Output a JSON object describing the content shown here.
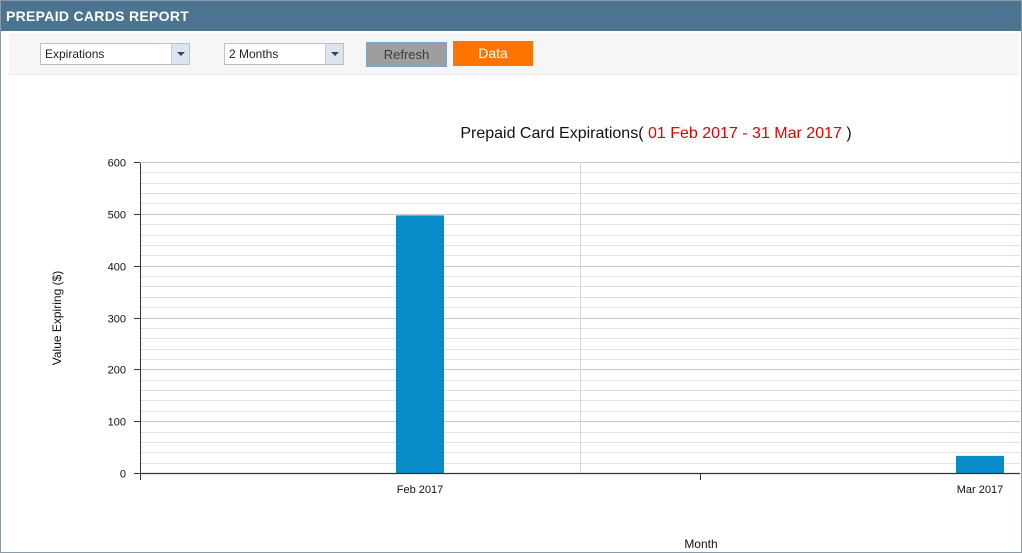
{
  "header": {
    "title": "PREPAID CARDS REPORT"
  },
  "toolbar": {
    "report_type": {
      "selected": "Expirations"
    },
    "period": {
      "selected": "2 Months"
    },
    "refresh_label": "Refresh",
    "data_label": "Data"
  },
  "chart_data": {
    "type": "bar",
    "title": "Prepaid Card Expirations(",
    "title_range": " 01 Feb 2017 - 31 Mar 2017",
    "title_end": " )",
    "xlabel": "Month",
    "ylabel": "Value Expiring ($)",
    "categories": [
      "Feb 2017",
      "Mar 2017"
    ],
    "values": [
      497,
      33
    ],
    "ylim": [
      0,
      600
    ],
    "yticks": [
      0,
      100,
      200,
      300,
      400,
      500,
      600
    ],
    "grid": true,
    "color": "#078bc9"
  }
}
